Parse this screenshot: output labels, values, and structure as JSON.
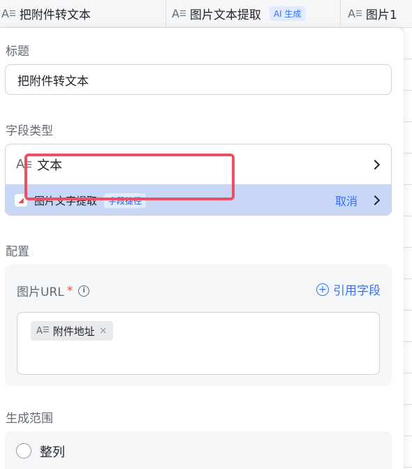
{
  "header": {
    "columns": [
      {
        "label": "把附件转文本"
      },
      {
        "label": "图片文本提取",
        "tag": "AI 生成"
      },
      {
        "label": "图片1"
      }
    ]
  },
  "panel": {
    "title_section": {
      "label": "标题",
      "value": "把附件转文本"
    },
    "type_section": {
      "label": "字段类型",
      "current_type": "文本",
      "shortcut": {
        "label": "图片文字提取",
        "tag": "字段捷径",
        "cancel": "取消"
      }
    },
    "config_section": {
      "label": "配置",
      "url_label": "图片URL",
      "required_mark": "*",
      "info_icon_glyph": "i",
      "ref_button": "引用字段",
      "chip": {
        "label": "附件地址",
        "close": "×"
      }
    },
    "range_section": {
      "label": "生成范围",
      "option": "整列"
    }
  },
  "colors": {
    "accent": "#3370ff",
    "shortcut_bg": "#c9d7f7",
    "highlight_border": "#f04f63",
    "required": "#f54a45"
  },
  "icons": {
    "text_field": "text-field-icon",
    "chevron": "chevron-right-icon",
    "plugin": "plugin-icon",
    "info": "info-icon",
    "add": "plus-circle-icon",
    "close": "close-icon"
  }
}
